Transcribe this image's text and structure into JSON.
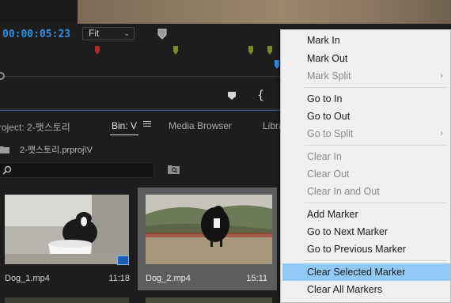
{
  "monitor": {
    "timecode": "00:00:05:23",
    "zoom_select": "Fit",
    "marker_colors": [
      "#b1282a",
      "#7a8a28",
      "#7a8a28",
      "#7a8a28",
      "#2e8de6"
    ]
  },
  "project_panel": {
    "tabs": [
      {
        "label": "roject: 2-팻스토리",
        "active": false
      },
      {
        "label": "Bin: V",
        "active": true
      },
      {
        "label": "Media Browser",
        "active": false
      },
      {
        "label": "Libra",
        "active": false
      }
    ],
    "bin_path": "2-팻스토리.prproj\\V",
    "search_placeholder": "",
    "clips": [
      {
        "name": "Dog_1.mp4",
        "duration": "11:18",
        "selected": false
      },
      {
        "name": "Dog_2.mp4",
        "duration": "15:11",
        "selected": true
      }
    ]
  },
  "context_menu": {
    "items": [
      {
        "label": "Mark In",
        "enabled": true,
        "submenu": false
      },
      {
        "label": "Mark Out",
        "enabled": true,
        "submenu": false
      },
      {
        "label": "Mark Split",
        "enabled": false,
        "submenu": true
      },
      {
        "label": "Go to In",
        "enabled": true,
        "submenu": false
      },
      {
        "label": "Go to Out",
        "enabled": true,
        "submenu": false
      },
      {
        "label": "Go to Split",
        "enabled": false,
        "submenu": true
      },
      {
        "label": "Clear In",
        "enabled": false,
        "submenu": false
      },
      {
        "label": "Clear Out",
        "enabled": false,
        "submenu": false
      },
      {
        "label": "Clear In and Out",
        "enabled": false,
        "submenu": false
      },
      {
        "label": "Add Marker",
        "enabled": true,
        "submenu": false
      },
      {
        "label": "Go to Next Marker",
        "enabled": true,
        "submenu": false
      },
      {
        "label": "Go to Previous Marker",
        "enabled": true,
        "submenu": false
      },
      {
        "label": "Clear Selected Marker",
        "enabled": true,
        "submenu": false,
        "highlighted": true
      },
      {
        "label": "Clear All Markers",
        "enabled": true,
        "submenu": false
      }
    ],
    "highlight_color": "#91c9f7"
  }
}
